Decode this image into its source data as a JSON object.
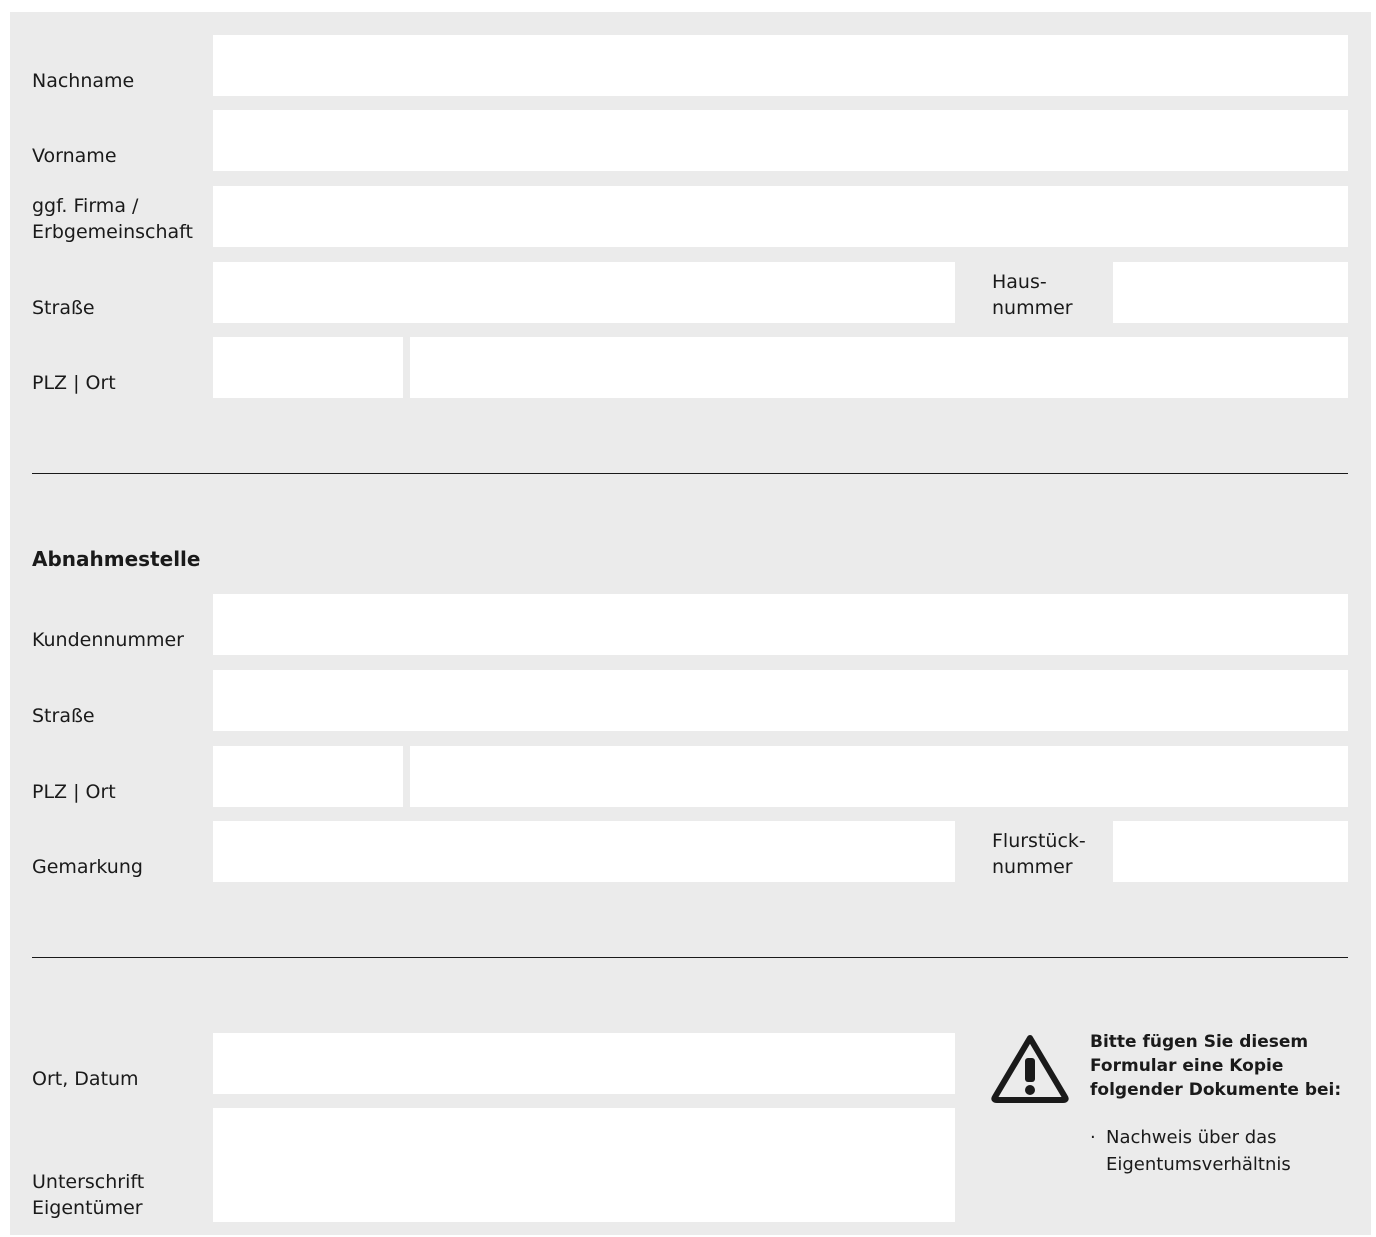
{
  "owner": {
    "nachname_label": "Nachname",
    "vorname_label": "Vorname",
    "firma_label_1": "ggf. Firma /",
    "firma_label_2": "Erbgemeinschaft",
    "strasse_label": "Straße",
    "hausnummer_label_1": "Haus-",
    "hausnummer_label_2": "nummer",
    "plz_ort_label": "PLZ | Ort",
    "fields": {
      "nachname": "",
      "vorname": "",
      "firma": "",
      "strasse": "",
      "hausnummer": "",
      "plz": "",
      "ort": ""
    }
  },
  "abnahmestelle": {
    "title": "Abnahmestelle",
    "kundennummer_label": "Kundennummer",
    "strasse_label": "Straße",
    "plz_ort_label": "PLZ | Ort",
    "gemarkung_label": "Gemarkung",
    "flurstueck_label_1": "Flurstück-",
    "flurstueck_label_2": "nummer",
    "fields": {
      "kundennummer": "",
      "strasse": "",
      "plz": "",
      "ort": "",
      "gemarkung": "",
      "flurstueck": ""
    }
  },
  "signature": {
    "ort_datum_label": "Ort, Datum",
    "unterschrift_label_1": "Unterschrift",
    "unterschrift_label_2": "Eigentümer",
    "fields": {
      "ort_datum": "",
      "unterschrift": ""
    }
  },
  "notice": {
    "icon": "warning-triangle-icon",
    "title_1": "Bitte fügen Sie diesem",
    "title_2": "Formular eine Kopie",
    "title_3": "folgender Dokumente bei:",
    "bullet": "·",
    "item_line_1": "Nachweis über das",
    "item_line_2": "Eigentumsverhältnis"
  },
  "colors": {
    "background": "#ebebeb",
    "field": "#ffffff",
    "text": "#1a1a1a"
  }
}
